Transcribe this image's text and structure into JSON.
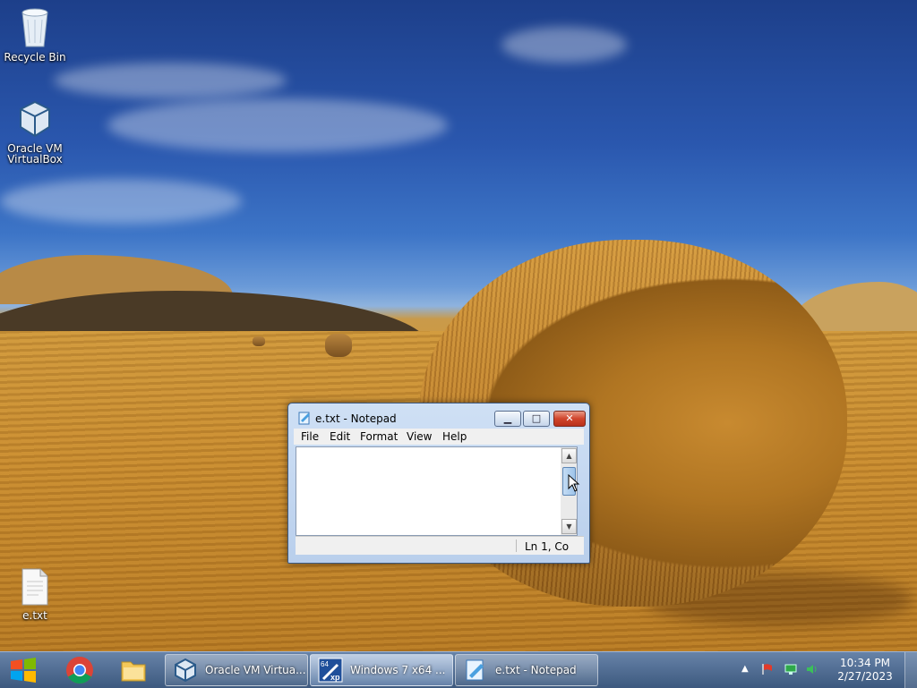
{
  "desktop": {
    "icons": [
      {
        "label": "Recycle Bin",
        "icon": "recycle-bin-icon"
      },
      {
        "label": "Oracle VM VirtualBox",
        "icon": "virtualbox-icon"
      },
      {
        "label": "e.txt",
        "icon": "text-file-icon"
      }
    ]
  },
  "notepad": {
    "title": "e.txt - Notepad",
    "menu": [
      "File",
      "Edit",
      "Format",
      "View",
      "Help"
    ],
    "content": "",
    "status": "Ln 1, Co"
  },
  "taskbar": {
    "pinned": [
      {
        "icon": "windows-start-icon"
      },
      {
        "icon": "chrome-icon"
      },
      {
        "icon": "file-explorer-icon"
      }
    ],
    "tasks": [
      {
        "label": "Oracle VM Virtua...",
        "icon": "virtualbox-icon"
      },
      {
        "label": "Windows 7 x64 ...",
        "icon": "windows-xp-vm-icon"
      },
      {
        "label": "e.txt - Notepad",
        "icon": "notepad-icon"
      }
    ],
    "clock": {
      "time": "10:34 PM",
      "date": "2/27/2023"
    }
  },
  "colors": {
    "taskbar": "#3a6290",
    "close": "#c8402a",
    "accent": "#5d86b5"
  }
}
